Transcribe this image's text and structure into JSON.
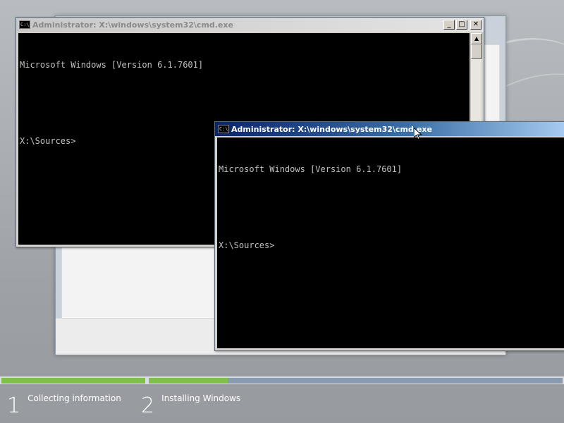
{
  "cmd_back": {
    "title": "Administrator: X:\\windows\\system32\\cmd.exe",
    "line1": "Microsoft Windows [Version 6.1.7601]",
    "line2": "",
    "line3": "X:\\Sources>",
    "icon": "cmd-icon",
    "minimize": "_",
    "maximize": "□",
    "close": "✕"
  },
  "cmd_front": {
    "title": "Administrator: X:\\windows\\system32\\cmd.exe",
    "line1": "Microsoft Windows [Version 6.1.7601]",
    "line2": "",
    "line3": "X:\\Sources>",
    "icon": "cmd-icon"
  },
  "setup": {
    "steps": [
      {
        "number": "1",
        "label": "Collecting information"
      },
      {
        "number": "2",
        "label": "Installing Windows"
      }
    ],
    "progress": {
      "step1_fraction": 1.0,
      "step2_fraction": 0.19,
      "complete_color": "#7fc04a",
      "remaining_color": "#8a9bb0"
    }
  },
  "colors": {
    "console_bg": "#000000",
    "console_text": "#c0c0c0",
    "active_title": "#0a246a"
  }
}
